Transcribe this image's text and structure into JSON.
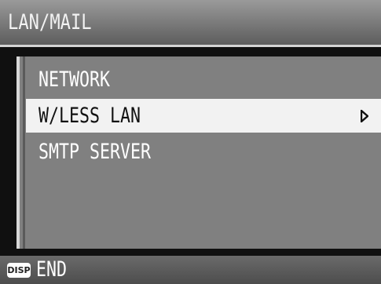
{
  "title": "LAN/MAIL",
  "menu": {
    "items": [
      {
        "label": "NETWORK",
        "selected": false
      },
      {
        "label": "W/LESS LAN",
        "selected": true,
        "icon": "right-triangle-icon"
      },
      {
        "label": "SMTP SERVER",
        "selected": false
      }
    ]
  },
  "footer": {
    "disp_label": "DISP",
    "end_label": "END"
  }
}
